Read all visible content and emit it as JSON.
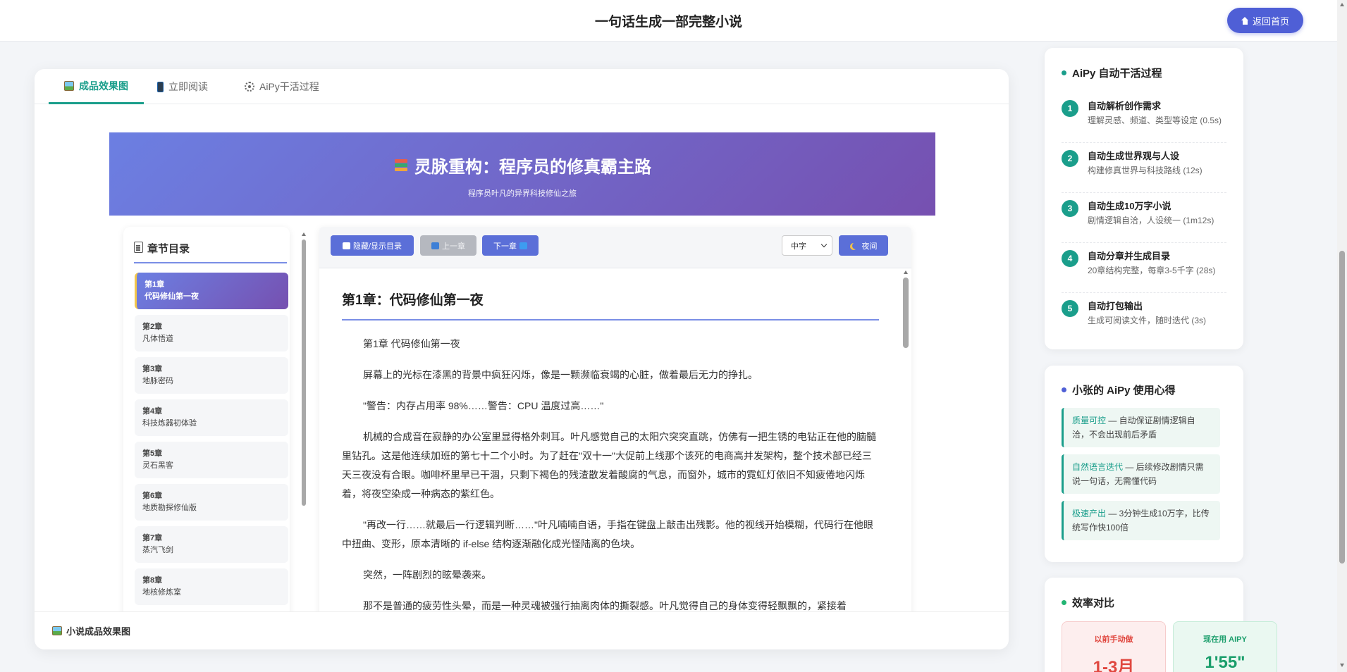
{
  "header": {
    "title": "一句话生成一部完整小说",
    "home_button": "返回首页"
  },
  "tabs": [
    {
      "label": "成品效果图",
      "icon": "picture-icon",
      "active": true
    },
    {
      "label": "立即阅读",
      "icon": "phone-icon",
      "active": false
    },
    {
      "label": "AiPy干活过程",
      "icon": "gear-icon",
      "active": false
    }
  ],
  "novel": {
    "title": "灵脉重构：程序员的修真霸主路",
    "subtitle": "程序员叶凡的异界科技修仙之旅"
  },
  "toc": {
    "heading": "章节目录",
    "items": [
      {
        "num": "第1章",
        "name": "代码修仙第一夜"
      },
      {
        "num": "第2章",
        "name": "凡体悟道"
      },
      {
        "num": "第3章",
        "name": "地脉密码"
      },
      {
        "num": "第4章",
        "name": "科技炼器初体验"
      },
      {
        "num": "第5章",
        "name": "灵石黑客"
      },
      {
        "num": "第6章",
        "name": "地质勘探修仙版"
      },
      {
        "num": "第7章",
        "name": "蒸汽飞剑"
      },
      {
        "num": "第8章",
        "name": "地核修炼室"
      }
    ]
  },
  "reader": {
    "toggle_toc": "隐藏/显示目录",
    "prev": "上一章",
    "next": "下一章",
    "font_size": "中字",
    "night": "夜间",
    "chapter_title": "第1章：代码修仙第一夜",
    "paragraphs": [
      "第1章 代码修仙第一夜",
      "屏幕上的光标在漆黑的背景中疯狂闪烁，像是一颗濒临衰竭的心脏，做着最后无力的挣扎。",
      "\"警告：内存占用率 98%……警告：CPU 温度过高……\"",
      "机械的合成音在寂静的办公室里显得格外刺耳。叶凡感觉自己的太阳穴突突直跳，仿佛有一把生锈的电钻正在他的脑髓里钻孔。这是他连续加班的第七十二个小时。为了赶在\"双十一\"大促前上线那个该死的电商高并发架构，整个技术部已经三天三夜没有合眼。咖啡杯里早已干涸，只剩下褐色的残渣散发着酸腐的气息，而窗外，城市的霓虹灯依旧不知疲倦地闪烁着，将夜空染成一种病态的紫红色。",
      "\"再改一行……就最后一行逻辑判断……\"叶凡喃喃自语，手指在键盘上敲击出残影。他的视线开始模糊，代码行在他眼中扭曲、变形，原本清晰的 if-else 结构逐渐融化成光怪陆离的色块。",
      "突然，一阵剧烈的眩晕袭来。",
      "那不是普通的疲劳性头晕，而是一种灵魂被强行抽离肉体的撕裂感。叶凡觉得自己的身体变得轻飘飘的，紧接着"
    ]
  },
  "bottom_label": "小说成品效果图",
  "process": {
    "heading": "AiPy 自动干活过程",
    "steps": [
      {
        "num": "1",
        "title": "自动解析创作需求",
        "desc": "理解灵感、频道、类型等设定 (0.5s)"
      },
      {
        "num": "2",
        "title": "自动生成世界观与人设",
        "desc": "构建修真世界与科技路线 (12s)"
      },
      {
        "num": "3",
        "title": "自动生成10万字小说",
        "desc": "剧情逻辑自洽，人设统一 (1m12s)"
      },
      {
        "num": "4",
        "title": "自动分章并生成目录",
        "desc": "20章结构完整，每章3-5千字 (28s)"
      },
      {
        "num": "5",
        "title": "自动打包输出",
        "desc": "生成可阅读文件，随时迭代 (3s)"
      }
    ]
  },
  "tips": {
    "heading": "小张的 AiPy 使用心得",
    "items": [
      {
        "key": "质量可控",
        "text": " — 自动保证剧情逻辑自洽，不会出现前后矛盾"
      },
      {
        "key": "自然语言迭代",
        "text": " — 后续修改剧情只需说一句话，无需懂代码"
      },
      {
        "key": "极速产出",
        "text": " — 3分钟生成10万字，比传统写作快100倍"
      }
    ]
  },
  "efficiency": {
    "heading": "效率对比",
    "before_label": "以前手动做",
    "before_value": "1-3月",
    "after_label": "现在用 AIPY",
    "after_value": "1'55\""
  },
  "colors": {
    "accent": "#1a9e8b",
    "brand": "#4f5fd6",
    "banner_start": "#6c7fe2",
    "banner_end": "#7650b0"
  }
}
